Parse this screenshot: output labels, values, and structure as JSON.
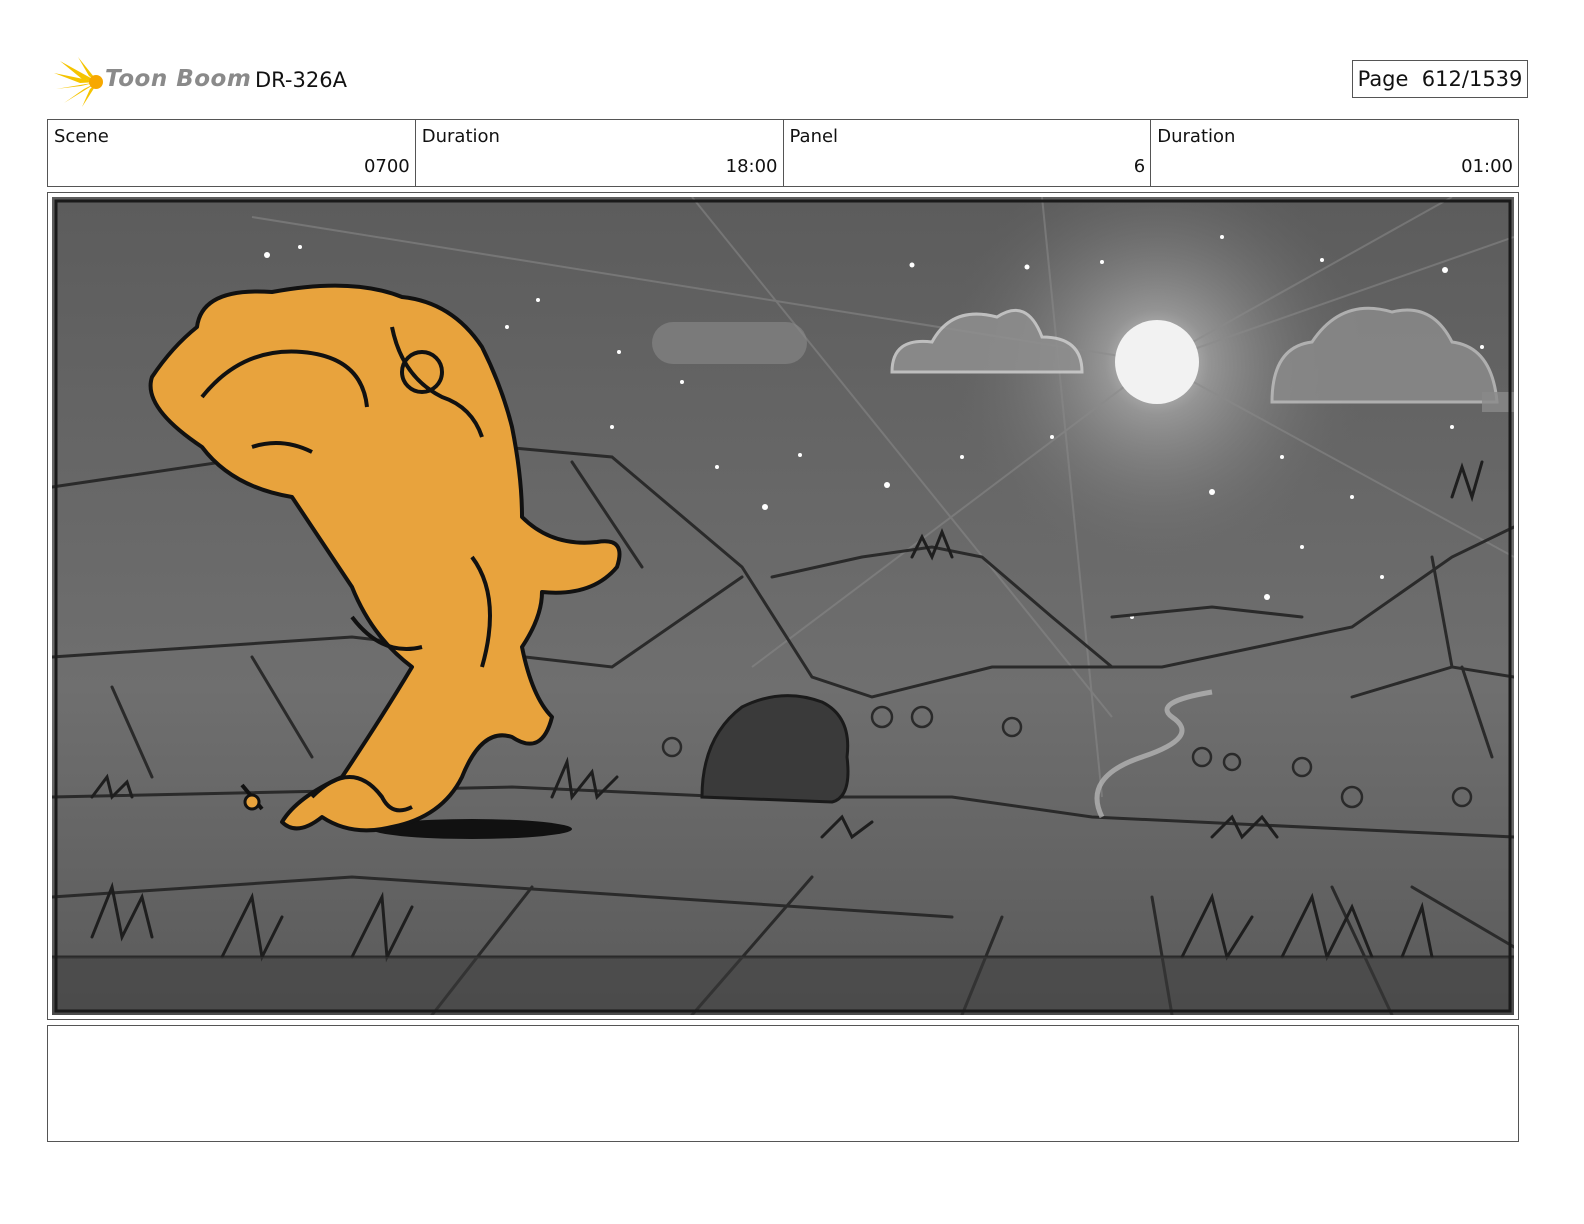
{
  "header": {
    "logo_text": "Toon Boom",
    "production_code": "DR-326A",
    "page_label": "Page",
    "page_number": "612/1539"
  },
  "info": {
    "scene_label": "Scene",
    "scene_value": "0700",
    "scene_duration_label": "Duration",
    "scene_duration_value": "18:00",
    "panel_label": "Panel",
    "panel_value": "6",
    "panel_duration_label": "Duration",
    "panel_duration_value": "01:00"
  },
  "panel": {
    "character_color": "#e8a33d",
    "sky_color": "#6b6b6b"
  },
  "caption": {
    "text": ""
  }
}
